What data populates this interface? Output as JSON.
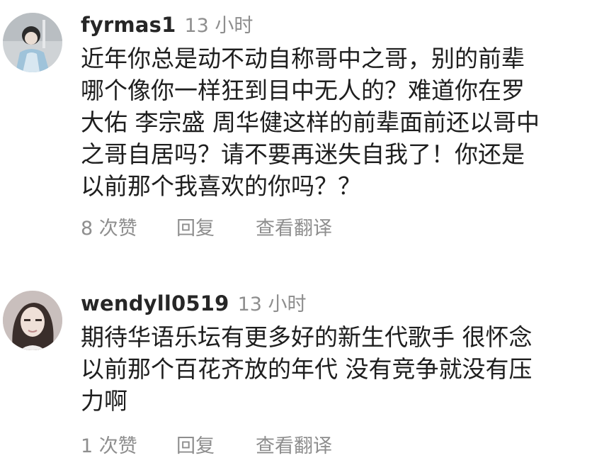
{
  "comments": [
    {
      "username": "fyrmas1",
      "time": "13 小时",
      "text": "近年你总是动不动自称哥中之哥，别的前辈\n哪个像你一样狂到目中无人的？难道你在罗\n大佑 李宗盛 周华健这样的前辈面前还以哥中\n之哥自居吗？请不要再迷失自我了！你还是\n以前那个我喜欢的你吗？？",
      "likes": "8 次赞",
      "reply": "回复",
      "translate": "查看翻译"
    },
    {
      "username": "wendyll0519",
      "time": "13 小时",
      "text": "期待华语乐坛有更多好的新生代歌手 很怀念\n以前那个百花齐放的年代 没有竞争就没有压\n力啊",
      "likes": "1 次赞",
      "reply": "回复",
      "translate": "查看翻译"
    }
  ]
}
